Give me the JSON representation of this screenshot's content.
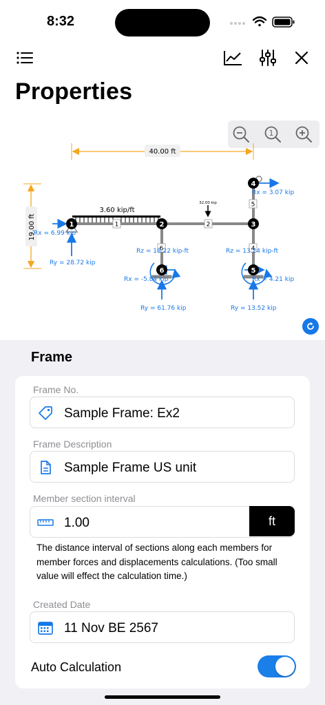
{
  "status": {
    "time": "8:32"
  },
  "toolbar": {
    "menu_icon": "list-icon",
    "chart_icon": "chart-line-icon",
    "sliders_icon": "sliders-icon",
    "close_icon": "close-icon"
  },
  "page_title": "Properties",
  "zoom": {
    "out_icon": "zoom-out-icon",
    "reset_icon": "zoom-reset-icon",
    "reset_text": "1",
    "in_icon": "zoom-in-icon"
  },
  "diagram": {
    "width_label": "40.00 ft",
    "height_label": "19.00 ft",
    "dist_load": "3.60 kip/ft",
    "point_load": "32.00 kip",
    "nodes": [
      "1",
      "2",
      "3",
      "4",
      "5",
      "6"
    ],
    "members": [
      "1",
      "2",
      "5",
      "4",
      "6"
    ],
    "reactions": {
      "rx1": "Rx = 6.99 kip",
      "ry1": "Ry = 28.72 kip",
      "rz6": "Rz = 18.22 kip-ft",
      "rx6": "Rx = -5.84 kip",
      "ry6": "Ry = 61.76 kip",
      "rz5": "Rz = 13.24 kip-ft",
      "rx5": "Rx = 4.21 kip",
      "ry5": "Ry = 13.52 kip",
      "rx4": "Rx = 3.07 kip"
    },
    "accent_color": "#1778e8",
    "dimension_color": "#f5a623"
  },
  "section": {
    "title": "Frame"
  },
  "form": {
    "frame_no": {
      "label": "Frame No.",
      "value": "Sample Frame: Ex2",
      "icon": "tag-icon"
    },
    "frame_description": {
      "label": "Frame Description",
      "value": "Sample Frame  US unit",
      "icon": "document-icon"
    },
    "interval": {
      "label": "Member section interval",
      "value": "1.00",
      "unit": "ft",
      "icon": "ruler-icon"
    },
    "help": "The distance interval of sections along each members for member forces and displacements calculations. (Too small value will effect the calculation time.)",
    "created_date": {
      "label": "Created Date",
      "value": "11 Nov BE 2567",
      "icon": "calendar-icon"
    },
    "auto_calc": {
      "label": "Auto Calculation",
      "enabled": true
    }
  },
  "colors": {
    "toggle_on": "#1a7fe8",
    "background_grouped": "#f1f1f5"
  }
}
